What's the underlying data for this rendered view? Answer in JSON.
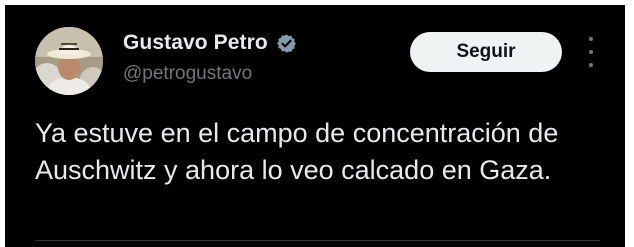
{
  "post": {
    "author": {
      "display_name": "Gustavo Petro",
      "handle": "@petrogustavo",
      "verified": true,
      "avatar_icon": "profile-photo"
    },
    "follow_label": "Seguir",
    "more_icon": "more-options-vertical-icon",
    "text": "Ya estuve en el campo de concentración de Auschwitz y ahora lo veo calcado en Gaza."
  },
  "colors": {
    "background": "#000000",
    "primary_text": "#e7e9ea",
    "secondary_text": "#71767b",
    "button_bg": "#eff3f4",
    "button_text": "#0f1419",
    "verified_badge": "#829aab"
  }
}
